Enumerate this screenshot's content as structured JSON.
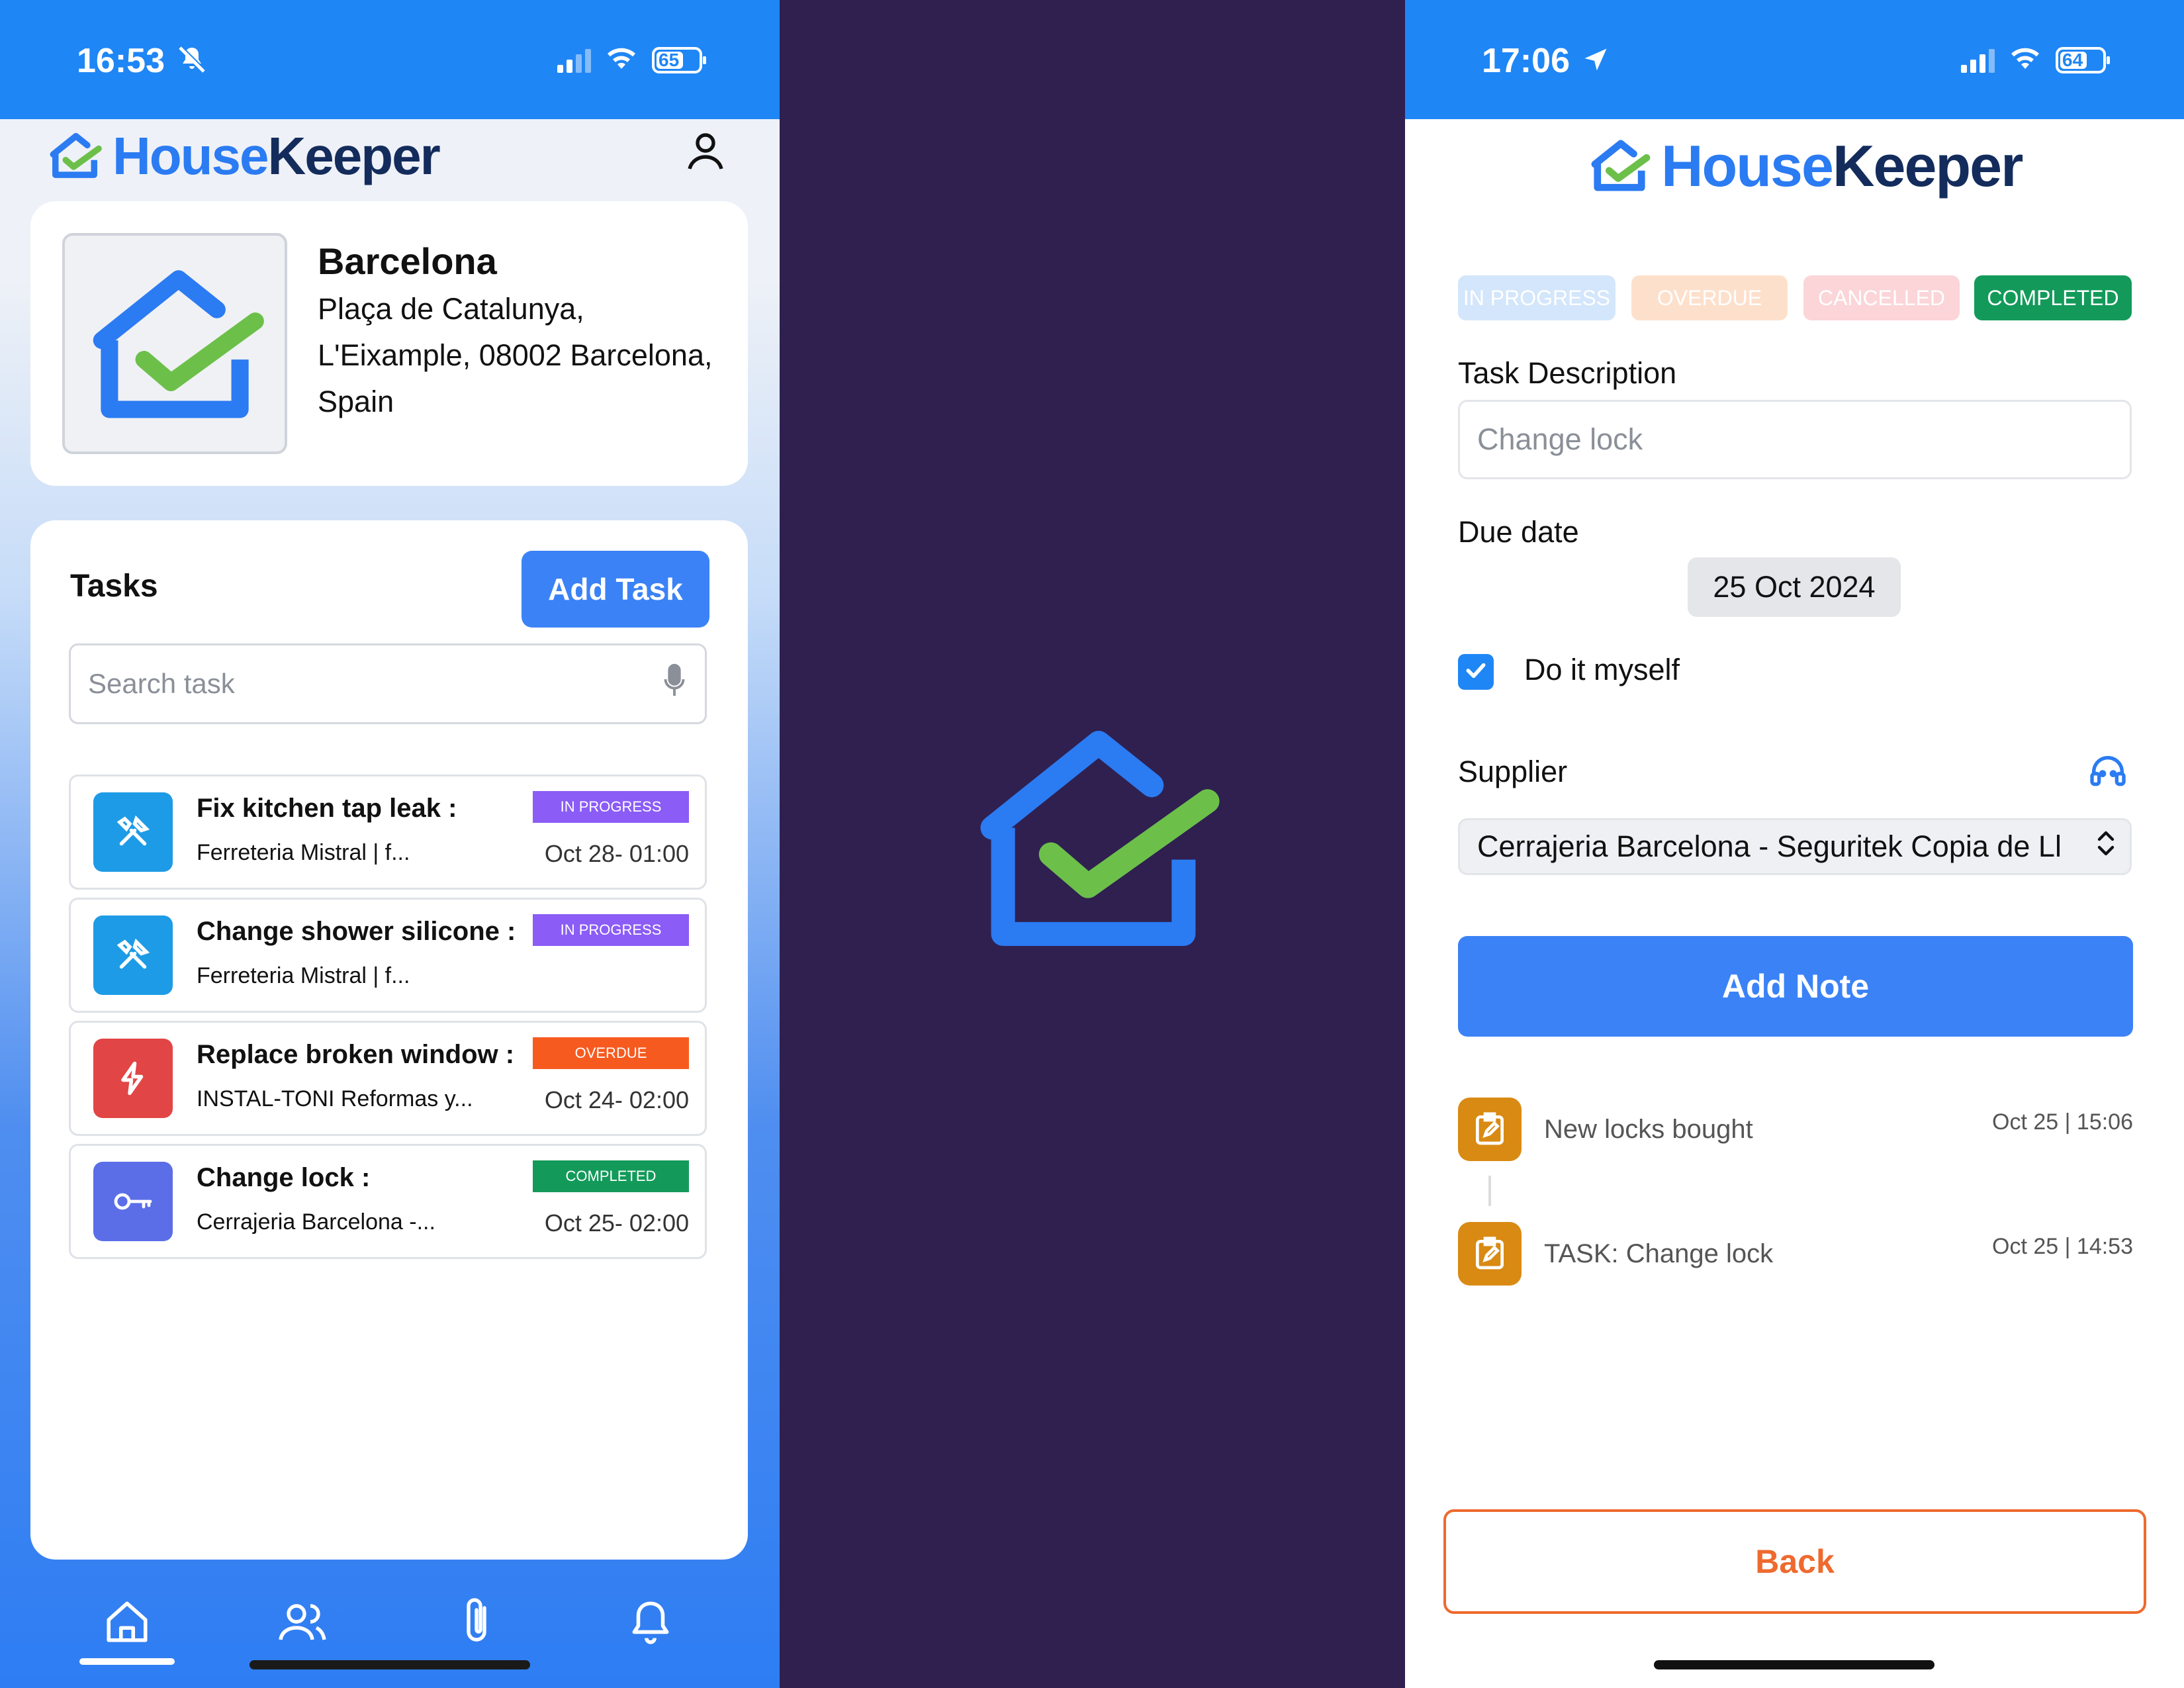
{
  "left_screen": {
    "status_bar": {
      "time": "16:53",
      "battery": "65",
      "battery_level": 0.65
    },
    "header": {
      "brand_part1": "House",
      "brand_part2": "Keeper"
    },
    "property": {
      "name": "Barcelona",
      "address_line1": "Plaça de Catalunya,",
      "address_line2": "L'Eixample, 08002 Barcelona,",
      "address_line3": "Spain"
    },
    "tasks": {
      "title": "Tasks",
      "add_button": "Add Task",
      "search_placeholder": "Search task",
      "items": [
        {
          "name": "Fix kitchen tap leak :",
          "supplier": "Ferreteria Mistral | f...",
          "status": "IN PROGRESS",
          "date": "Oct 28- 01:00",
          "icon": "tools-icon",
          "icon_color": "#1e9be6",
          "badge_color": "#8b5cf6"
        },
        {
          "name": "Change shower silicone :",
          "supplier": "Ferreteria Mistral | f...",
          "status": "IN PROGRESS",
          "date": "",
          "icon": "tools-icon",
          "icon_color": "#1e9be6",
          "badge_color": "#8b5cf6"
        },
        {
          "name": "Replace broken window :",
          "supplier": "INSTAL-TONI Reformas y...",
          "status": "OVERDUE",
          "date": "Oct 24- 02:00",
          "icon": "lightning-icon",
          "icon_color": "#e24545",
          "badge_color": "#f75a1f"
        },
        {
          "name": "Change lock :",
          "supplier": "Cerrajeria Barcelona -...",
          "status": "COMPLETED",
          "date": "Oct 25- 02:00",
          "icon": "key-icon",
          "icon_color": "#5b6ee8",
          "badge_color": "#139a5a"
        }
      ]
    },
    "nav": [
      "home-icon",
      "users-icon",
      "paperclip-icon",
      "bell-icon"
    ]
  },
  "right_screen": {
    "status_bar": {
      "time": "17:06",
      "battery": "64",
      "battery_level": 0.64
    },
    "header": {
      "brand_part1": "House",
      "brand_part2": "Keeper"
    },
    "status_filters": [
      {
        "label": "IN PROGRESS",
        "bg": "#d3e6fb",
        "fg": "#ffffff"
      },
      {
        "label": "OVERDUE",
        "bg": "#fde0cc",
        "fg": "#ffffff"
      },
      {
        "label": "CANCELLED",
        "bg": "#fbd5d8",
        "fg": "#ffffff"
      },
      {
        "label": "COMPLETED",
        "bg": "#139a5a",
        "fg": "#ffffff"
      }
    ],
    "form": {
      "description_label": "Task Description",
      "description_value": "Change lock",
      "due_label": "Due date",
      "due_value": "25 Oct 2024",
      "do_it_myself_label": "Do it myself",
      "do_it_myself_checked": true,
      "supplier_label": "Supplier",
      "supplier_value": "Cerrajeria Barcelona - Seguritek Copia de Ll",
      "add_note_button": "Add Note"
    },
    "notes": [
      {
        "text": "New locks bought",
        "time": "Oct 25 | 15:06"
      },
      {
        "text": "TASK: Change lock",
        "time": "Oct 25 | 14:53"
      }
    ],
    "back_button": "Back"
  },
  "colors": {
    "primary": "#2b7bf2",
    "status_bar": "#1f86f5",
    "splash_bg": "#2f2050",
    "check_green": "#6cc04a",
    "back_orange": "#ee6a2e"
  }
}
